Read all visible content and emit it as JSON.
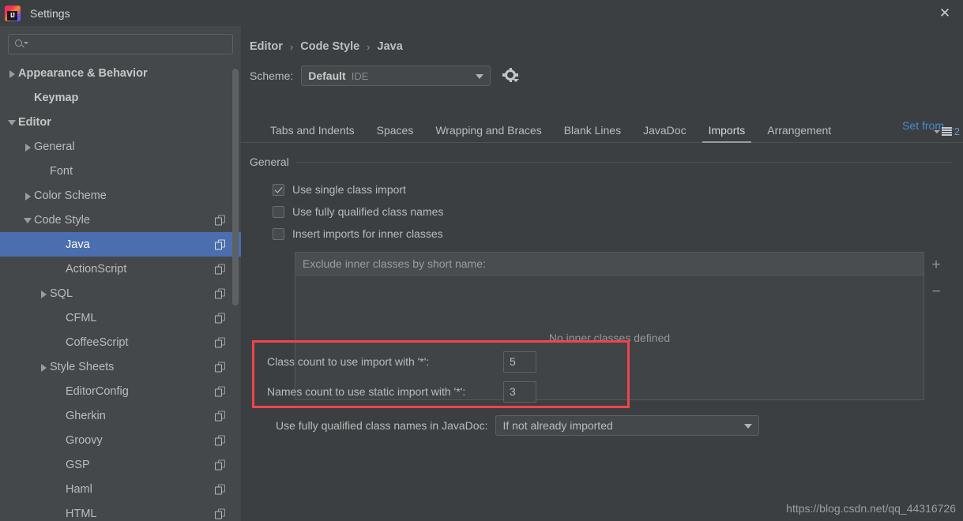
{
  "window": {
    "title": "Settings",
    "logo_icon": "intellij-idea-logo",
    "close_icon": "close-icon"
  },
  "sidebar": {
    "search": {
      "value": "",
      "placeholder": "",
      "icon": "search-icon"
    },
    "items": [
      {
        "label": "Appearance & Behavior",
        "arrow": "right",
        "indent": 0,
        "bold": true,
        "copy": false,
        "selected": false
      },
      {
        "label": "Keymap",
        "arrow": "none",
        "indent": 1,
        "bold": true,
        "copy": false,
        "selected": false
      },
      {
        "label": "Editor",
        "arrow": "down",
        "indent": 0,
        "bold": true,
        "copy": false,
        "selected": false
      },
      {
        "label": "General",
        "arrow": "right",
        "indent": 1,
        "bold": false,
        "copy": false,
        "selected": false
      },
      {
        "label": "Font",
        "arrow": "none",
        "indent": 2,
        "bold": false,
        "copy": false,
        "selected": false
      },
      {
        "label": "Color Scheme",
        "arrow": "right",
        "indent": 1,
        "bold": false,
        "copy": false,
        "selected": false
      },
      {
        "label": "Code Style",
        "arrow": "down",
        "indent": 1,
        "bold": false,
        "copy": true,
        "selected": false
      },
      {
        "label": "Java",
        "arrow": "none",
        "indent": 3,
        "bold": false,
        "copy": true,
        "selected": true
      },
      {
        "label": "ActionScript",
        "arrow": "none",
        "indent": 3,
        "bold": false,
        "copy": true,
        "selected": false
      },
      {
        "label": "SQL",
        "arrow": "right",
        "indent": 2,
        "bold": false,
        "copy": true,
        "selected": false
      },
      {
        "label": "CFML",
        "arrow": "none",
        "indent": 3,
        "bold": false,
        "copy": true,
        "selected": false
      },
      {
        "label": "CoffeeScript",
        "arrow": "none",
        "indent": 3,
        "bold": false,
        "copy": true,
        "selected": false
      },
      {
        "label": "Style Sheets",
        "arrow": "right",
        "indent": 2,
        "bold": false,
        "copy": true,
        "selected": false
      },
      {
        "label": "EditorConfig",
        "arrow": "none",
        "indent": 3,
        "bold": false,
        "copy": true,
        "selected": false
      },
      {
        "label": "Gherkin",
        "arrow": "none",
        "indent": 3,
        "bold": false,
        "copy": true,
        "selected": false
      },
      {
        "label": "Groovy",
        "arrow": "none",
        "indent": 3,
        "bold": false,
        "copy": true,
        "selected": false
      },
      {
        "label": "GSP",
        "arrow": "none",
        "indent": 3,
        "bold": false,
        "copy": true,
        "selected": false
      },
      {
        "label": "Haml",
        "arrow": "none",
        "indent": 3,
        "bold": false,
        "copy": true,
        "selected": false
      },
      {
        "label": "HTML",
        "arrow": "none",
        "indent": 3,
        "bold": false,
        "copy": true,
        "selected": false
      }
    ]
  },
  "main": {
    "breadcrumb": {
      "items": [
        "Editor",
        "Code Style",
        "Java"
      ],
      "separator": "›"
    },
    "scheme": {
      "label": "Scheme:",
      "value": "Default",
      "sub": "IDE",
      "gear_icon": "gear-icon"
    },
    "set_from_link": "Set from…",
    "tabs": [
      {
        "label": "Tabs and Indents",
        "active": false
      },
      {
        "label": "Spaces",
        "active": false
      },
      {
        "label": "Wrapping and Braces",
        "active": false
      },
      {
        "label": "Blank Lines",
        "active": false
      },
      {
        "label": "JavaDoc",
        "active": false
      },
      {
        "label": "Imports",
        "active": true
      },
      {
        "label": "Arrangement",
        "active": false
      }
    ],
    "tab_overflow_count": "2",
    "general": {
      "title": "General",
      "checkboxes": [
        {
          "label": "Use single class import",
          "checked": true
        },
        {
          "label": "Use fully qualified class names",
          "checked": false
        },
        {
          "label": "Insert imports for inner classes",
          "checked": false
        }
      ]
    },
    "exclude_table": {
      "header": "Exclude inner classes by short name:",
      "empty_text": "No inner classes defined",
      "rows": [],
      "add_label": "+",
      "remove_label": "−"
    },
    "javadoc": {
      "label": "Use fully qualified class names in JavaDoc:",
      "value": "If not already imported"
    },
    "highlighted": {
      "border_color": "#f0444c",
      "class_count_label": "Class count to use import with '*':",
      "class_count_value": "5",
      "names_count_label": "Names count to use static import with '*':",
      "names_count_value": "3"
    },
    "watermark": "https://blog.csdn.net/qq_44316726"
  },
  "colors": {
    "selection": "#4b6eaf",
    "link": "#4a88d8",
    "highlight": "#f0444c",
    "sidebar_bg": "#45484a",
    "panel_bg": "#3c3f41"
  }
}
